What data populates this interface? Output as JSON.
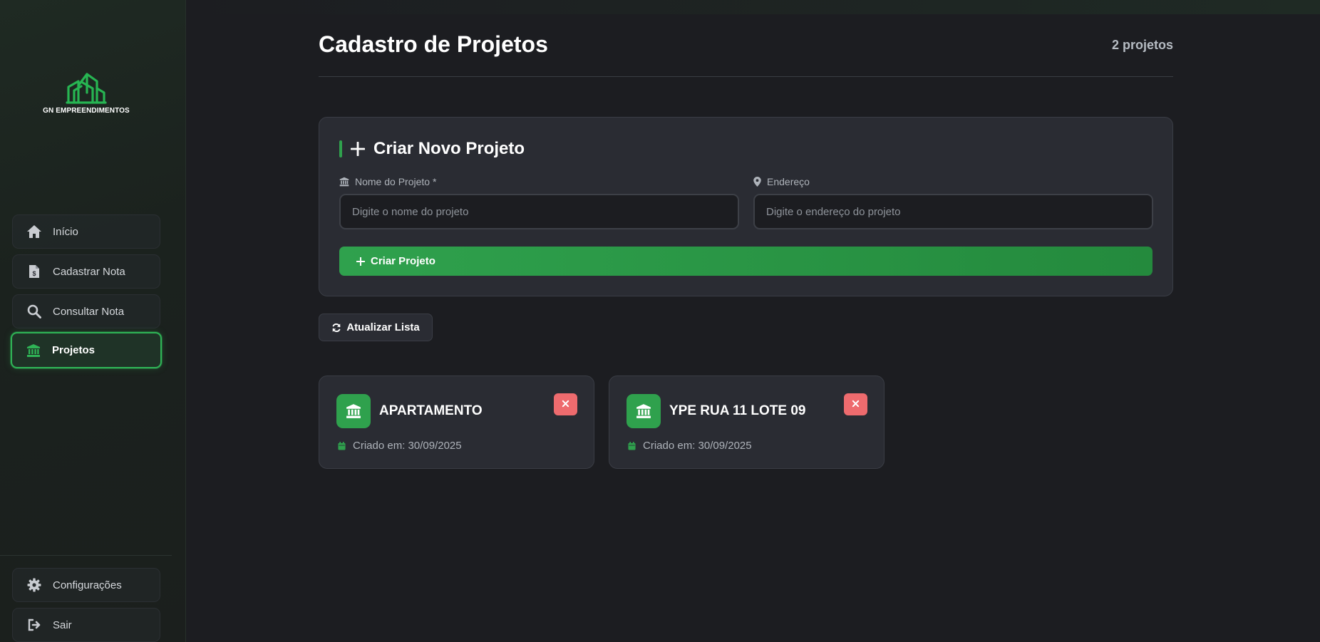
{
  "brand": {
    "name": "GN EMPREENDIMENTOS",
    "accent": "#2fa14d",
    "danger": "#ee6b6e"
  },
  "sidebar": {
    "items": [
      {
        "label": "Início",
        "icon": "home-icon"
      },
      {
        "label": "Cadastrar Nota",
        "icon": "file-invoice-icon"
      },
      {
        "label": "Consultar Nota",
        "icon": "search-icon"
      },
      {
        "label": "Projetos",
        "icon": "bank-icon",
        "active": true
      }
    ],
    "bottom": [
      {
        "label": "Configurações",
        "icon": "gear-icon"
      },
      {
        "label": "Sair",
        "icon": "sign-out-icon"
      }
    ]
  },
  "header": {
    "title": "Cadastro de Projetos",
    "count": "2 projetos"
  },
  "create_form": {
    "heading": "Criar Novo Projeto",
    "name_label": "Nome do Projeto *",
    "name_placeholder": "Digite o nome do projeto",
    "name_value": "",
    "address_label": "Endereço",
    "address_placeholder": "Digite o endereço do projeto",
    "address_value": "",
    "submit_label": "Criar Projeto"
  },
  "refresh_label": "Atualizar Lista",
  "projects": [
    {
      "name": "APARTAMENTO",
      "created": "Criado em: 30/09/2025"
    },
    {
      "name": "YPE RUA 11 LOTE 09",
      "created": "Criado em: 30/09/2025"
    }
  ]
}
